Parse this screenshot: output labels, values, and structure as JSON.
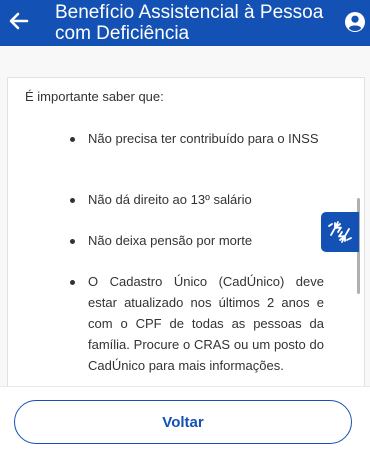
{
  "header": {
    "title": "Benefício Assistencial à Pessoa com Deficiência",
    "back_icon": "arrow-left-icon",
    "user_icon": "user-circle-icon",
    "background": "#1351b4"
  },
  "content": {
    "intro": "É importante saber que:",
    "items": [
      "Não precisa ter contribuído para o INSS",
      "Não dá direito ao 13º salário",
      "Não deixa pensão por morte",
      "O Cadastro Único (CadÚnico) deve estar atualizado nos últimos 2 anos e com o CPF de todas as pessoas da família. Procure o CRAS ou um posto do CadÚnico para mais informações."
    ]
  },
  "libras_button": {
    "icon": "sign-language-hands-icon"
  },
  "footer": {
    "back_label": "Voltar",
    "accent": "#1351b4"
  }
}
